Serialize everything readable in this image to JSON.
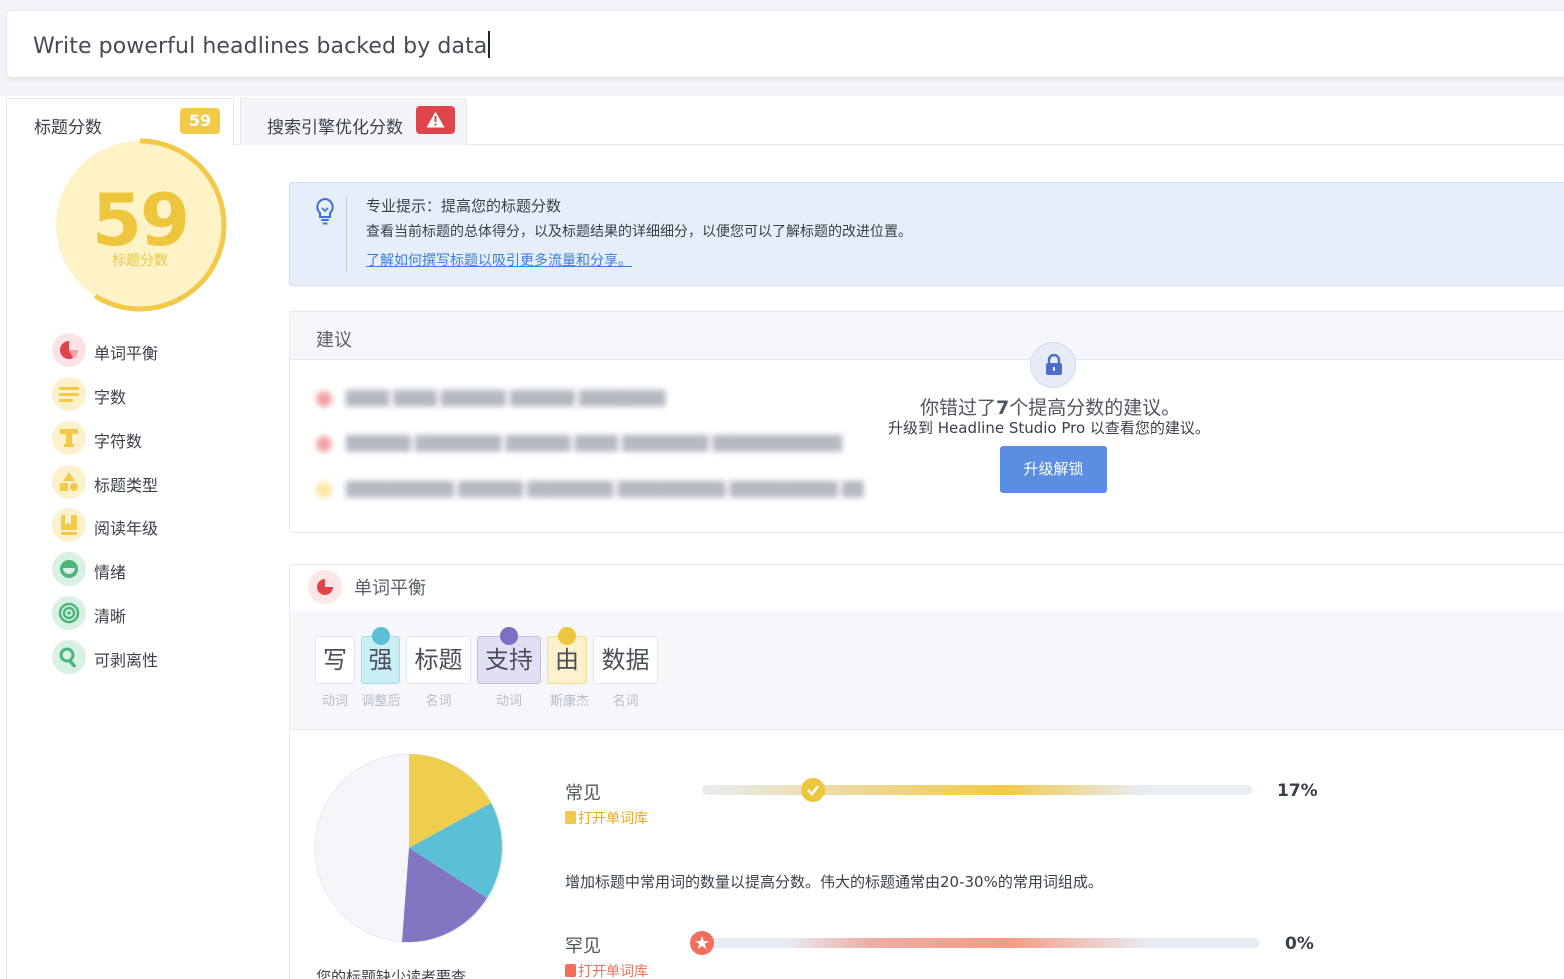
{
  "headline": {
    "value": "Write powerful headlines backed by data"
  },
  "tabs": [
    {
      "label": "标题分数",
      "badge": "59"
    },
    {
      "label": "搜索引擎优化分数",
      "badge_icon": "warning-icon"
    }
  ],
  "score": {
    "value": "59",
    "label": "标题分数",
    "color": "#eec63e"
  },
  "metrics": [
    {
      "label": "单词平衡",
      "icon": "pie-chart-icon",
      "color": "#e0454b"
    },
    {
      "label": "字数",
      "icon": "lines-icon",
      "color": "#f3c94a"
    },
    {
      "label": "字符数",
      "icon": "text-t-icon",
      "color": "#f3c94a"
    },
    {
      "label": "标题类型",
      "icon": "shapes-icon",
      "color": "#f3c94a"
    },
    {
      "label": "阅读年级",
      "icon": "bookmark-icon",
      "color": "#f3c94a"
    },
    {
      "label": "情绪",
      "icon": "smile-icon",
      "color": "#4cb67a"
    },
    {
      "label": "清晰",
      "icon": "target-icon",
      "color": "#4cb67a"
    },
    {
      "label": "可剥离性",
      "icon": "magnifier-icon",
      "color": "#4cb67a"
    }
  ],
  "tip": {
    "title": "专业提示：提高您的标题分数",
    "body": "查看当前标题的总体得分，以及标题结果的详细细分，以便您可以了解标题的改进位置。",
    "link": "了解如何撰写标题以吸引更多流量和分享。"
  },
  "suggestions": {
    "title": "建议",
    "missed_prefix": "你错过了",
    "missed_count": "7",
    "missed_suffix": "个提高分数的建议。",
    "upgrade_text": "升级到 Headline Studio Pro 以查看您的建议。",
    "unlock_button": "升级解锁"
  },
  "word_balance": {
    "title": "单词平衡",
    "words": [
      {
        "word": "写",
        "tag": "动词"
      },
      {
        "word": "强",
        "tag": "调整后"
      },
      {
        "word": "标题",
        "tag": "名词"
      },
      {
        "word": "支持",
        "tag": "动词"
      },
      {
        "word": "由",
        "tag": "斯康杰"
      },
      {
        "word": "数据",
        "tag": "名词"
      }
    ],
    "pie_caption": "您的标题缺少读者要查",
    "common": {
      "label": "常见",
      "open_lib": "打开单词库",
      "percent": "17%",
      "value": 0.17,
      "color": "#f3c94a"
    },
    "hint": "增加标题中常用词的数量以提高分数。伟大的标题通常由20-30%的常用词组成。",
    "rare": {
      "label": "罕见",
      "open_lib": "打开单词库",
      "percent": "0%",
      "value": 0.0,
      "color": "#f2705b"
    }
  }
}
